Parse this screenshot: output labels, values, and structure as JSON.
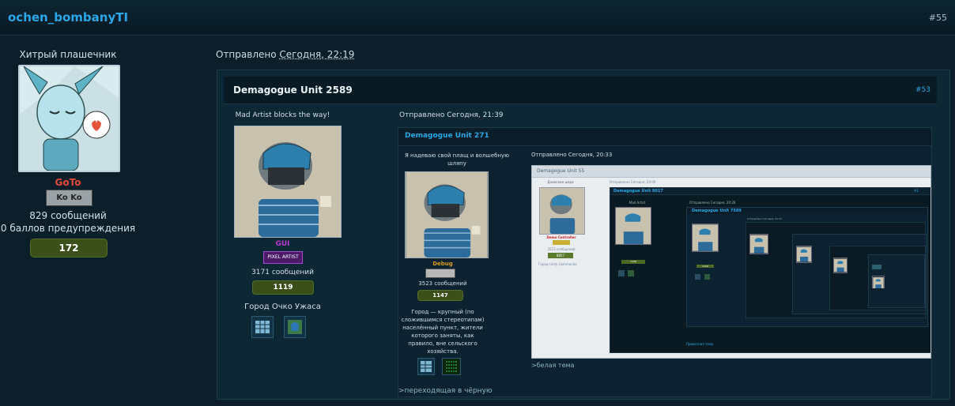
{
  "header": {
    "username": "ochen_bombanyTI",
    "post_number": "#55"
  },
  "author": {
    "title": "Хитрый плашечник",
    "name": "GoTo",
    "badge_text": "Ko Ko",
    "messages": "829 сообщений",
    "warnings": "0 баллов предупреждения",
    "rep": "172"
  },
  "post": {
    "sent_label": "Отправлено",
    "sent_time": "Сегодня, 22:19"
  },
  "quote1": {
    "name": "Demagogue Unit 2589",
    "post_number": "#53",
    "author_title": "Mad Artist blocks the way!",
    "author_name": "GUI",
    "badge_text": "PIXEL ARTIST",
    "messages": "3171 сообщений",
    "rep": "1119",
    "city": "Город Очко Ужаса",
    "sent": "Отправлено Сегодня, 21:39"
  },
  "quote2": {
    "name": "Demagogue Unit 271",
    "author_title": "Я надеваю свой плащ и волшебную шляпу",
    "author_name": "Debug",
    "messages": "3523 сообщений",
    "rep": "1147",
    "city_desc": "Город — крупный (по сложившимся стереотипам) населённый пункт, жители которого заняты, как правило, вне сельского хозяйства.",
    "sent": "Отправлено Сегодня, 20:33",
    "footer_text": ">переходящая в чёрную"
  },
  "quote3": {
    "name": "Demagogue Unit 55",
    "author_title": "Дамаскин шара",
    "author_name": "Demo Controller",
    "messages": "3523 сообщений",
    "rep": "8857",
    "city": "Город Unity Commando",
    "sent": "Отправлено Сегодня, 20:09",
    "footer_text": ">белая тема"
  },
  "nested": {
    "n1_name": "Demagogue Unit 8917",
    "n1_num": "#1",
    "n1_sent": "Отправлено Сегодня, 20:28",
    "n1_author": "Mad Artist",
    "n2_name": "Demagogue Unit 7589",
    "n2_sent": "Отправлено Сегодня, 21:19",
    "n2_rep": "1119",
    "n1_rep": "1138",
    "bottom_link": "Приватная тема"
  }
}
